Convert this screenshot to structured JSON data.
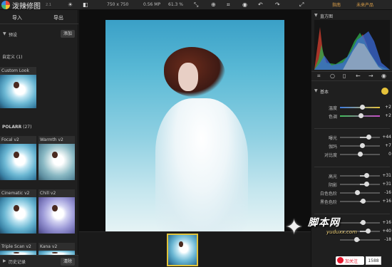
{
  "app": {
    "title": "泼辣修图",
    "version": "2.1",
    "dimensions": "750 x 750",
    "megapixels": "0.56 MP",
    "zoom": "61.3 %",
    "guide_link": "指南",
    "unnamed_link": "未来产品"
  },
  "left_panel": {
    "import_tab": "导入",
    "export_tab": "导出",
    "presets_header": "预设",
    "add_button": "添加",
    "custom_group": "自定义 (1)",
    "custom_item": "Custom Look",
    "polarr_group": "POLARR",
    "polarr_count": "(27)",
    "presets": [
      {
        "label": "Focal v2"
      },
      {
        "label": "Warmth v2"
      },
      {
        "label": "Cinematic v2"
      },
      {
        "label": "Chill v2"
      },
      {
        "label": "Triple Scan v2"
      },
      {
        "label": "Kana v2"
      }
    ],
    "history_label": "历史记录",
    "clear_button": "清除"
  },
  "right_panel": {
    "histogram_label": "直方图",
    "basic_label": "基本",
    "sliders": [
      {
        "label": "温度",
        "value": "+2",
        "pos": 0.55,
        "style": "temp"
      },
      {
        "label": "色调",
        "value": "+2",
        "pos": 0.52,
        "style": "tint"
      },
      {
        "label": "曝光",
        "value": "+44",
        "pos": 0.72,
        "style": "plain"
      },
      {
        "label": "伽玛",
        "value": "+7",
        "pos": 0.56,
        "style": "plain"
      },
      {
        "label": "对比度",
        "value": "0",
        "pos": 0.5,
        "style": "plain"
      },
      {
        "label": "高光",
        "value": "+31",
        "pos": 0.66,
        "style": "plain"
      },
      {
        "label": "阴影",
        "value": "+31",
        "pos": 0.66,
        "style": "plain"
      },
      {
        "label": "白色色阶",
        "value": "-16",
        "pos": 0.42,
        "style": "plain"
      },
      {
        "label": "黑色色阶",
        "value": "+16",
        "pos": 0.58,
        "style": "plain"
      },
      {
        "label": "",
        "value": "+16",
        "pos": 0.58,
        "style": "plain"
      },
      {
        "label": "",
        "value": "+40",
        "pos": 0.7,
        "style": "plain"
      },
      {
        "label": "",
        "value": "-18",
        "pos": 0.41,
        "style": "plain"
      }
    ]
  },
  "watermark": {
    "main": "脚本网",
    "sub": "yuduxx.com"
  },
  "follow": {
    "label": "加关注",
    "count": "1588"
  },
  "colors": {
    "accent": "#e1c33a",
    "link": "#e0a24a",
    "weibo": "#e6162d"
  }
}
